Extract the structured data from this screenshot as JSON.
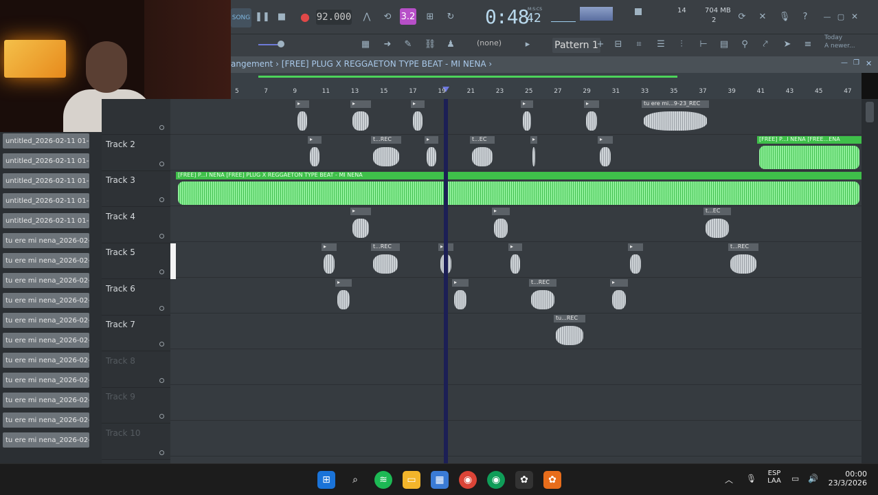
{
  "toolbar": {
    "song_badge": "SONG",
    "tempo": "92.000",
    "time_main": "0:48",
    "time_sub": "42",
    "time_label": "M:S:CS",
    "cpu_value": "14",
    "mem_value": "704 MB",
    "mem_sub": "2",
    "pattern_none": "(none)",
    "pattern_label": "Pattern 1",
    "hint_line1": "Today",
    "hint_line2": "A newer..."
  },
  "breadcrumb": {
    "text": "angement › [FREE] PLUG X REGGAETON TYPE BEAT - MI NENA ›"
  },
  "ruler": {
    "ticks": [
      "5",
      "7",
      "9",
      "11",
      "13",
      "15",
      "17",
      "19",
      "21",
      "23",
      "25",
      "27",
      "29",
      "31",
      "33",
      "35",
      "37",
      "39",
      "41",
      "43",
      "45",
      "47"
    ]
  },
  "sidebar": {
    "samples": [
      "untitled_2026-02-11 01-...",
      "untitled_2026-02-11 01-...",
      "untitled_2026-02-11 01-...",
      "untitled_2026-02-11 01-...",
      "untitled_2026-02-11 01-...",
      "tu ere mi nena_2026-02-...",
      "tu ere mi nena_2026-02-...",
      "tu ere mi nena_2026-02-...",
      "tu ere mi nena_2026-02-...",
      "tu ere mi nena_2026-02-...",
      "tu ere mi nena_2026-02-...",
      "tu ere mi nena_2026-02-...",
      "tu ere mi nena_2026-02-...",
      "tu ere mi nena_2026-02-...",
      "tu ere mi nena_2026-02-...",
      "tu ere mi nena_2026-02-..."
    ]
  },
  "tracks": [
    {
      "name": ""
    },
    {
      "name": "Track 2"
    },
    {
      "name": "Track 3"
    },
    {
      "name": "Track 4"
    },
    {
      "name": "Track 5"
    },
    {
      "name": "Track 6"
    },
    {
      "name": "Track 7"
    },
    {
      "name": "Track 8"
    },
    {
      "name": "Track 9"
    },
    {
      "name": "Track 10"
    }
  ],
  "clips": {
    "main_audio": "[FREE] P...I NENA  [FREE] PLUG X REGGAETON TYPE BEAT - MI NENA",
    "t1_rec": "tu ere mi...9-23_REC",
    "t2_rec": "t...REC",
    "t2_ec": "t...EC",
    "t2_free": "[FREE] P...I NENA  [FREE...ENA",
    "t4_ec": "t...EC",
    "t5_rec": "t...REC",
    "t6_rec": "t...REC",
    "t7_rec": "tu...REC"
  },
  "taskbar": {
    "lang_line1": "ESP",
    "lang_line2": "LAA",
    "time": "00:00",
    "date": "23/3/2026"
  }
}
